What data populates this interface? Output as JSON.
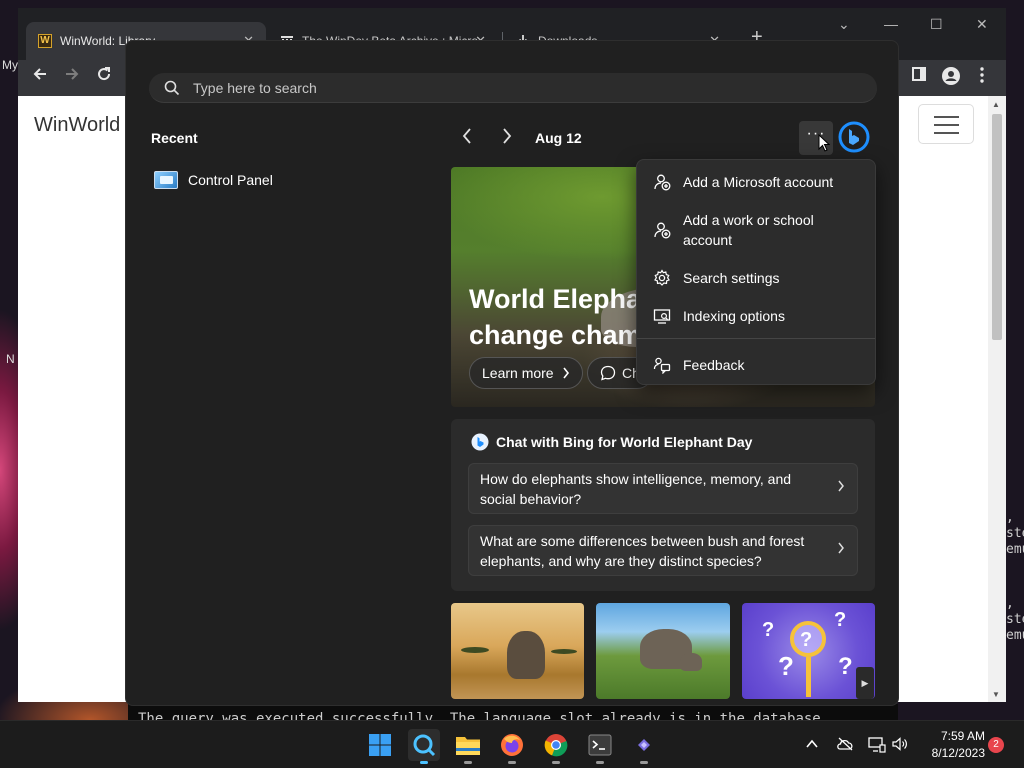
{
  "desktop": {
    "label_partial": "My",
    "label_partial2": "N"
  },
  "browser": {
    "tabs": [
      {
        "title": "WinWorld: Library",
        "active": true
      },
      {
        "title": "The WinDev Beta Archive : Micro",
        "active": false
      },
      {
        "title": "Downloads",
        "active": false
      }
    ],
    "tab_close": "✕",
    "new_tab": "+",
    "controls": {
      "chevron": "⌄",
      "minimize": "—",
      "maximize": "☐",
      "close": "✕"
    },
    "site_logo": "WinWorld"
  },
  "search_panel": {
    "search": {
      "placeholder": "Type here to search"
    },
    "recent": {
      "title": "Recent",
      "items": [
        {
          "label": "Control Panel",
          "icon": "control-panel-icon"
        }
      ]
    },
    "date_label": "Aug 12",
    "more_label": "···",
    "hero": {
      "title_line1": "World Elepha",
      "title_line2": "change cham",
      "learn_more": "Learn more",
      "chat_short": "Ch"
    },
    "menu": {
      "items": [
        {
          "label": "Add a Microsoft account",
          "icon": "add-account-icon"
        },
        {
          "label": "Add a work or school account",
          "icon": "add-account-icon"
        },
        {
          "label": "Search settings",
          "icon": "gear-icon"
        },
        {
          "label": "Indexing options",
          "icon": "indexing-icon"
        },
        {
          "label": "Feedback",
          "icon": "feedback-icon"
        }
      ]
    },
    "chat": {
      "title": "Chat with Bing for World Elephant Day",
      "questions": [
        "How do elephants show intelligence, memory, and social behavior?",
        "What are some differences between bush and forest elephants, and why are they distinct species?"
      ]
    }
  },
  "console": {
    "text": "The query was executed successfully. The language slot already is in the database."
  },
  "terminal_fragment": {
    "lines": [
      ",",
      "ste",
      "emu",
      ",",
      "ste",
      "emu"
    ]
  },
  "taskbar": {
    "apps": [
      "start",
      "search",
      "file-explorer",
      "firefox",
      "chrome",
      "terminal",
      "app"
    ],
    "tray": {
      "chevron": "^"
    },
    "clock": {
      "time": "7:59 AM",
      "date": "8/12/2023"
    },
    "notification_count": "2"
  },
  "colors": {
    "accent": "#0078d4",
    "bing": "#1e8fff",
    "panel_bg": "#202020",
    "menu_bg": "#2c2c2c"
  }
}
